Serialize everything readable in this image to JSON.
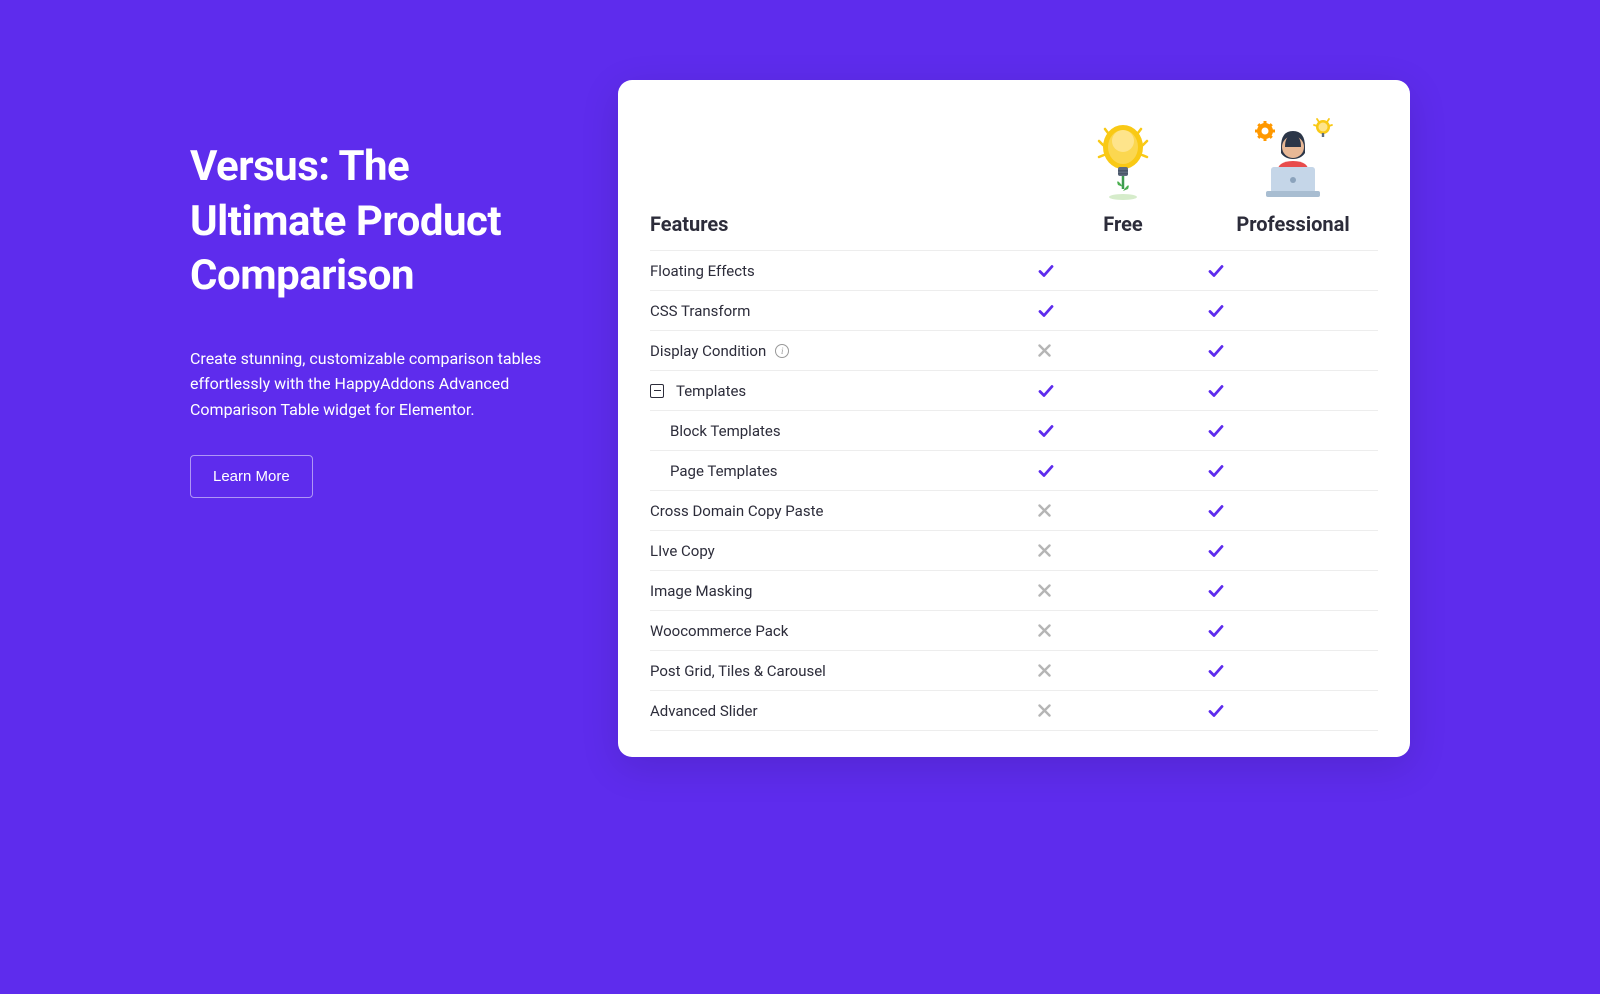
{
  "hero": {
    "heading": "Versus: The Ultimate Product Comparison",
    "description": "Create stunning, customizable comparison tables effortlessly with the HappyAddons Advanced Comparison Table widget for Elementor.",
    "cta_label": "Learn More"
  },
  "table": {
    "features_col_title": "Features",
    "plans": [
      {
        "title": "Free",
        "icon": "lightbulb-plant"
      },
      {
        "title": "Professional",
        "icon": "person-laptop-gears"
      }
    ],
    "rows": [
      {
        "label": "Floating Effects",
        "indent": 0,
        "collapsible": false,
        "info": false,
        "cells": [
          "check",
          "check"
        ]
      },
      {
        "label": "CSS Transform",
        "indent": 0,
        "collapsible": false,
        "info": false,
        "cells": [
          "check",
          "check"
        ]
      },
      {
        "label": "Display Condition",
        "indent": 0,
        "collapsible": false,
        "info": true,
        "cells": [
          "cross",
          "check"
        ]
      },
      {
        "label": "Templates",
        "indent": 0,
        "collapsible": true,
        "info": false,
        "cells": [
          "check",
          "check"
        ]
      },
      {
        "label": "Block Templates",
        "indent": 1,
        "collapsible": false,
        "info": false,
        "cells": [
          "check",
          "check"
        ]
      },
      {
        "label": "Page Templates",
        "indent": 1,
        "collapsible": false,
        "info": false,
        "cells": [
          "check",
          "check"
        ]
      },
      {
        "label": "Cross Domain Copy Paste",
        "indent": 0,
        "collapsible": false,
        "info": false,
        "cells": [
          "cross",
          "check"
        ]
      },
      {
        "label": "LIve Copy",
        "indent": 0,
        "collapsible": false,
        "info": false,
        "cells": [
          "cross",
          "check"
        ]
      },
      {
        "label": "Image Masking",
        "indent": 0,
        "collapsible": false,
        "info": false,
        "cells": [
          "cross",
          "check"
        ]
      },
      {
        "label": "Woocommerce Pack",
        "indent": 0,
        "collapsible": false,
        "info": false,
        "cells": [
          "cross",
          "check"
        ]
      },
      {
        "label": "Post Grid, Tiles & Carousel",
        "indent": 0,
        "collapsible": false,
        "info": false,
        "cells": [
          "cross",
          "check"
        ]
      },
      {
        "label": "Advanced Slider",
        "indent": 0,
        "collapsible": false,
        "info": false,
        "cells": [
          "cross",
          "check"
        ]
      }
    ]
  }
}
